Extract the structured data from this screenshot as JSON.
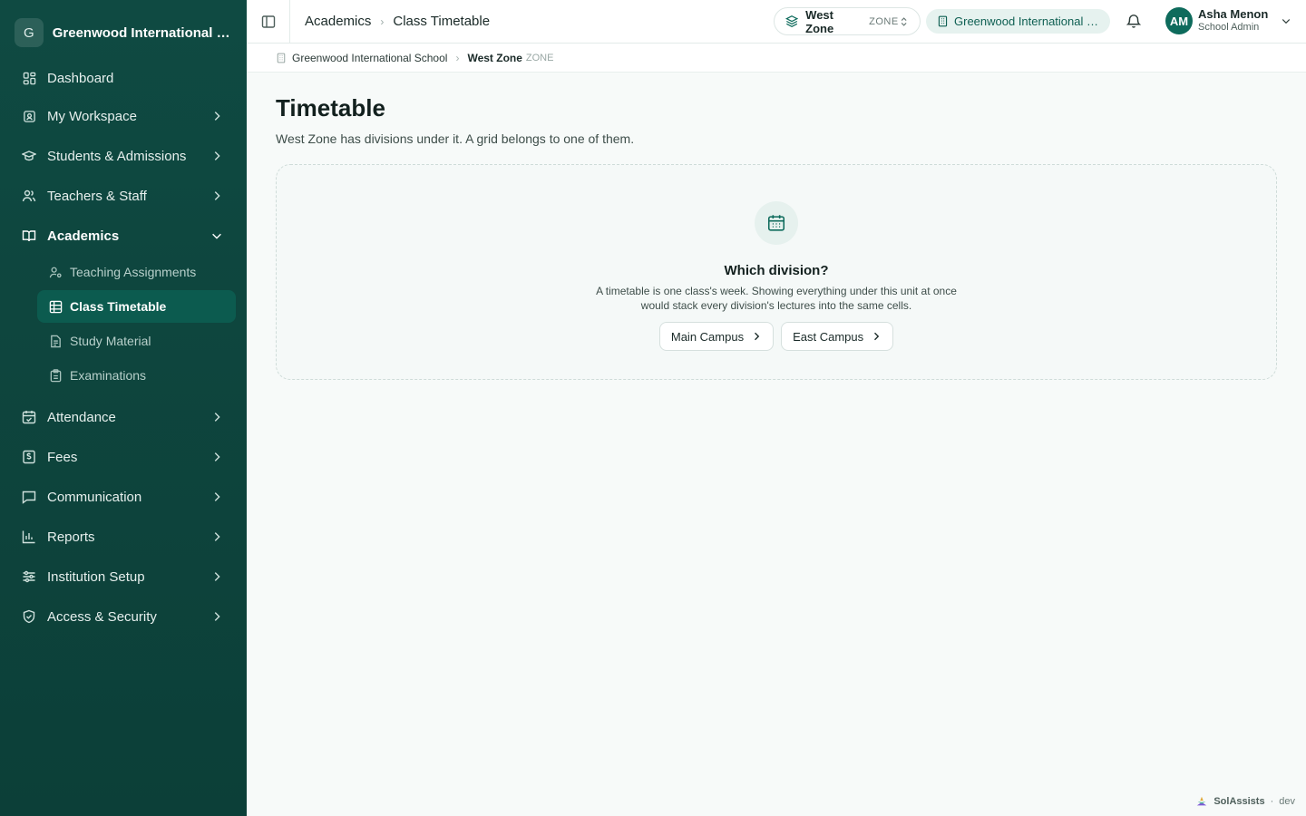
{
  "sidebar": {
    "brand_initial": "G",
    "brand_name": "Greenwood International School",
    "items": [
      {
        "label": "Dashboard"
      },
      {
        "label": "My Workspace"
      },
      {
        "label": "Students & Admissions"
      },
      {
        "label": "Teachers & Staff"
      },
      {
        "label": "Academics"
      },
      {
        "label": "Attendance"
      },
      {
        "label": "Fees"
      },
      {
        "label": "Communication"
      },
      {
        "label": "Reports"
      },
      {
        "label": "Institution Setup"
      },
      {
        "label": "Access & Security"
      }
    ],
    "academics_sub": [
      {
        "label": "Teaching Assignments"
      },
      {
        "label": "Class Timetable"
      },
      {
        "label": "Study Material"
      },
      {
        "label": "Examinations"
      }
    ]
  },
  "topbar": {
    "crumbs": [
      "Academics",
      "Class Timetable"
    ],
    "zone_name": "West Zone",
    "zone_tag": "ZONE",
    "school": "Greenwood International School",
    "user_initials": "AM",
    "user_name": "Asha Menon",
    "user_role": "School Admin"
  },
  "breadcrumb": {
    "school": "Greenwood International School",
    "zone": "West Zone",
    "zone_tag": "ZONE"
  },
  "main": {
    "title": "Timetable",
    "subtitle": "West Zone has divisions under it. A grid belongs to one of them.",
    "empty_title": "Which division?",
    "empty_text": "A timetable is one class's week. Showing everything under this unit at once would stack every division's lectures into the same cells.",
    "choices": [
      "Main Campus",
      "East Campus"
    ]
  },
  "footer": {
    "brand": "SolAssists",
    "env": "dev"
  },
  "colors": {
    "sidebar_bg": "#0f4a42",
    "accent": "#0e6b5c",
    "active_item": "#0c5b4f"
  }
}
